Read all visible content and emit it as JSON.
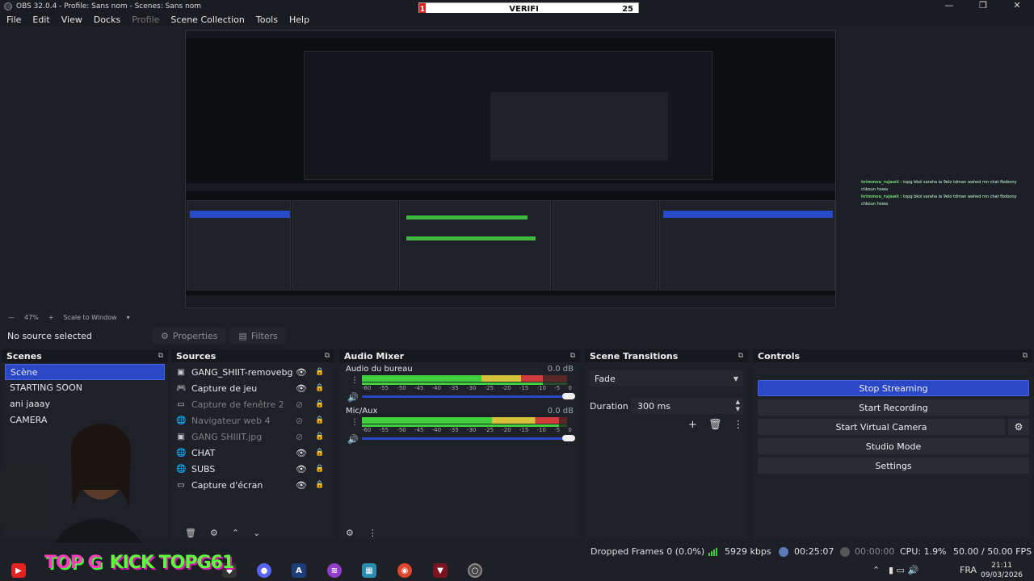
{
  "window": {
    "title": "OBS 32.0.4 - Profile: Sans nom - Scenes: Sans nom",
    "controls": [
      "—",
      "❐",
      "✕"
    ]
  },
  "overlay_box": {
    "left_num": "1",
    "label": "VERIFI",
    "right_num": "25"
  },
  "menu": [
    "File",
    "Edit",
    "View",
    "Docks",
    "Profile",
    "Scene Collection",
    "Tools",
    "Help"
  ],
  "preview_chat": [
    {
      "user": "hrimmou_rujawii :",
      "msg": "topg bkol saraha la 9elo tdman wahed mn chat fbobony chkoun howa"
    },
    {
      "user": "hrimmou_rujawii :",
      "msg": "topg bkol saraha la 9elo tdman wahed mn chat fbobony chkoun howa"
    }
  ],
  "zoombar": {
    "minus": "—",
    "zoom": "47%",
    "plus": "+",
    "scale": "Scale to Window",
    "arrow": "▾"
  },
  "context": {
    "no_source": "No source selected",
    "properties": "Properties",
    "filters": "Filters"
  },
  "docks": {
    "scenes": {
      "title": "Scenes",
      "items": [
        "Scène",
        "STARTING SOON",
        "ani jaaay",
        "CAMERA"
      ]
    },
    "sources": {
      "title": "Sources",
      "items": [
        {
          "type": "▣",
          "name": "GANG_SHIIT-removebg",
          "enabled": true,
          "locked": false
        },
        {
          "type": "🎮",
          "name": "Capture de jeu",
          "enabled": true,
          "locked": false
        },
        {
          "type": "▭",
          "name": "Capture de fenêtre 2",
          "enabled": false,
          "locked": false
        },
        {
          "type": "🌐",
          "name": "Navigateur web 4",
          "enabled": false,
          "locked": false
        },
        {
          "type": "▣",
          "name": "GANG SHIIIT.jpg",
          "enabled": false,
          "locked": false
        },
        {
          "type": "🌐",
          "name": "CHAT",
          "enabled": true,
          "locked": false
        },
        {
          "type": "🌐",
          "name": "SUBS",
          "enabled": true,
          "locked": false
        },
        {
          "type": "▭",
          "name": "Capture d'écran",
          "enabled": true,
          "locked": true
        }
      ],
      "eye_icon": "👁",
      "eye_off_icon": "⊘",
      "lock_icon": "🔒"
    },
    "audio_mixer": {
      "title": "Audio Mixer",
      "ticks": [
        "-60",
        "-55",
        "-50",
        "-45",
        "-40",
        "-35",
        "-30",
        "-25",
        "-20",
        "-15",
        "-10",
        "-5",
        "0"
      ],
      "channels": [
        {
          "name": "Audio du bureau",
          "db": "0.0 dB",
          "level": 0.88
        },
        {
          "name": "Mic/Aux",
          "db": "0.0 dB",
          "level": 0.96
        }
      ]
    },
    "scene_transitions": {
      "title": "Scene Transitions",
      "transition": "Fade",
      "duration_label": "Duration",
      "duration": "300 ms"
    },
    "controls": {
      "title": "Controls",
      "buttons": [
        "Stop Streaming",
        "Start Recording",
        "Start Virtual Camera",
        "Studio Mode",
        "Settings"
      ]
    }
  },
  "status": {
    "dropped": "Dropped Frames 0 (0.0%)",
    "kbps": "5929 kbps",
    "stream_time": "00:25:07",
    "rec_time": "00:00:00",
    "cpu": "CPU: 1.9%",
    "fps": "50.00 / 50.00 FPS"
  },
  "taskbar": {
    "lang": "FRA",
    "time": "21:11",
    "date": "09/03/2026"
  },
  "stream_overlay": {
    "text": "TOP G",
    "text2": "KICK TOPG61"
  },
  "colors": {
    "accent": "#2a47c6",
    "green": "#3fcf3f",
    "bg": "#1d1f26"
  }
}
